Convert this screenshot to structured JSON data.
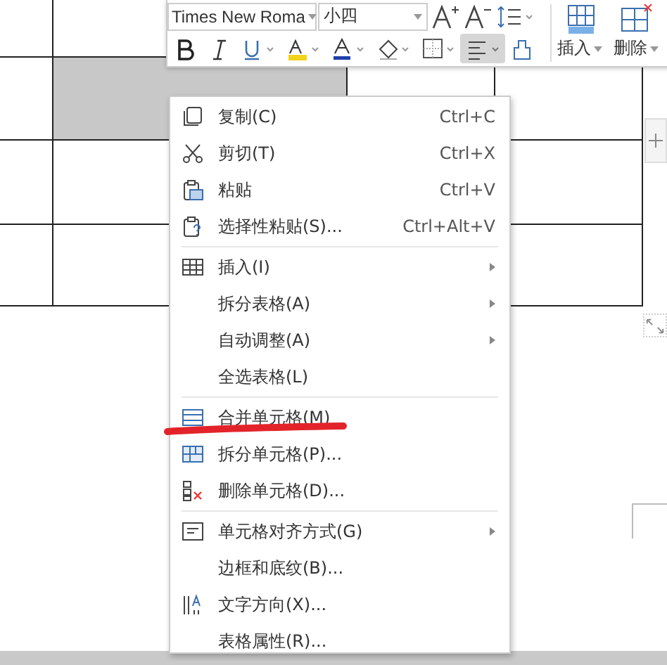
{
  "toolbar": {
    "font": "Times New Roma",
    "size": "小四",
    "format_buttons": [
      {
        "selected": false
      },
      {
        "selected": false
      },
      {
        "selected": false
      },
      {
        "selected": false
      },
      {
        "selected": false
      },
      {
        "selected": false
      },
      {
        "selected": false
      },
      {
        "selected": true
      },
      {
        "selected": false
      }
    ],
    "large_buttons": [
      {
        "label": "插入"
      },
      {
        "label": "删除"
      }
    ]
  },
  "table": {
    "rows": [
      {
        "selected": [
          false,
          false
        ]
      },
      {
        "selected": [
          false,
          true,
          false,
          false
        ]
      },
      {
        "selected": [
          false,
          false,
          false
        ]
      },
      {
        "selected": [
          false,
          false,
          false
        ]
      }
    ]
  },
  "context_menu": {
    "groups": [
      [
        {
          "label": "复制(C)",
          "shortcut": "Ctrl+C",
          "submenu": false
        },
        {
          "label": "剪切(T)",
          "shortcut": "Ctrl+X",
          "submenu": false
        },
        {
          "label": "粘贴",
          "shortcut": "Ctrl+V",
          "submenu": false
        },
        {
          "label": "选择性粘贴(S)...",
          "shortcut": "Ctrl+Alt+V",
          "submenu": false
        }
      ],
      [
        {
          "label": "插入(I)",
          "submenu": true
        },
        {
          "label": "拆分表格(A)",
          "submenu": true
        },
        {
          "label": "自动调整(A)",
          "submenu": true
        },
        {
          "label": "全选表格(L)",
          "submenu": false
        }
      ],
      [
        {
          "label": "合并单元格(M)",
          "submenu": false
        },
        {
          "label": "拆分单元格(P)...",
          "submenu": false
        },
        {
          "label": "删除单元格(D)...",
          "submenu": false
        }
      ],
      [
        {
          "label": "单元格对齐方式(G)",
          "submenu": true
        },
        {
          "label": "边框和底纹(B)...",
          "submenu": false
        },
        {
          "label": "文字方向(X)...",
          "submenu": false
        },
        {
          "label": "表格属性(R)...",
          "submenu": false
        }
      ]
    ]
  }
}
